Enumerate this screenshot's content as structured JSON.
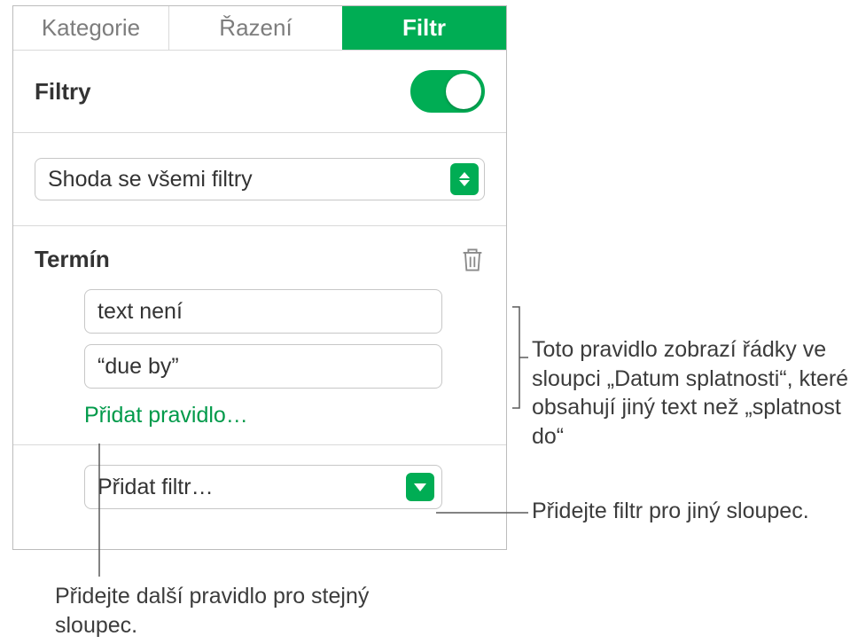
{
  "tabs": {
    "kategorie": "Kategorie",
    "razeni": "Řazení",
    "filtr": "Filtr"
  },
  "filters": {
    "heading": "Filtry",
    "toggle_on": true,
    "match_mode": "Shoda se všemi filtry"
  },
  "rule": {
    "column_label": "Termín",
    "condition": "text není",
    "value": "“due by”",
    "add_rule": "Přidat pravidlo…"
  },
  "add_filter": "Přidat filtr…",
  "callouts": {
    "rule_desc": "Toto pravidlo zobrazí řádky ve sloupci „Datum splatnosti“, které obsahují jiný text než „splatnost do“",
    "add_filter_desc": "Přidejte filtr pro jiný sloupec.",
    "add_rule_desc": "Přidejte další pravidlo pro stejný sloupec."
  },
  "colors": {
    "accent": "#00ad54"
  }
}
